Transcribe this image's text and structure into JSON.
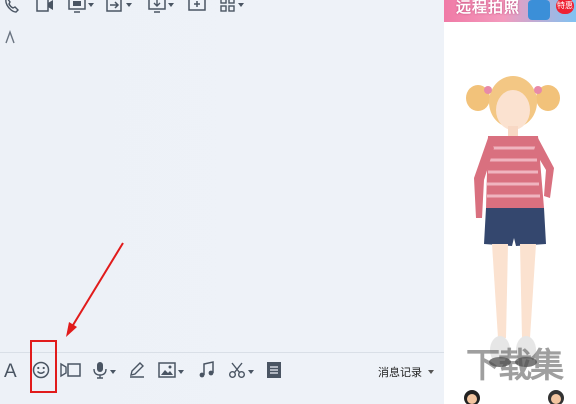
{
  "top_toolbar": {
    "items": [
      {
        "icon": "phone-icon"
      },
      {
        "icon": "video-call-icon"
      },
      {
        "icon": "remote-desktop-icon"
      },
      {
        "icon": "file-transfer-icon"
      },
      {
        "icon": "screen-share-icon"
      },
      {
        "icon": "add-apps-icon"
      },
      {
        "icon": "grid-apps-icon"
      }
    ]
  },
  "bottom_toolbar": {
    "font_label": "A",
    "items": [
      {
        "icon": "font-icon"
      },
      {
        "icon": "emoji-icon"
      },
      {
        "icon": "video-message-icon"
      },
      {
        "icon": "voice-message-icon"
      },
      {
        "icon": "pen-icon"
      },
      {
        "icon": "image-icon"
      },
      {
        "icon": "music-icon"
      },
      {
        "icon": "scissors-icon"
      },
      {
        "icon": "history-file-icon"
      }
    ],
    "history_label": "消息记录"
  },
  "ad": {
    "text": "远程拍照",
    "badge": "特惠"
  },
  "watermark": "下载集",
  "colors": {
    "toolbar_icon": "#4a5563",
    "annotation_red": "#e11b1b",
    "chat_bg": "#edf1f7"
  }
}
